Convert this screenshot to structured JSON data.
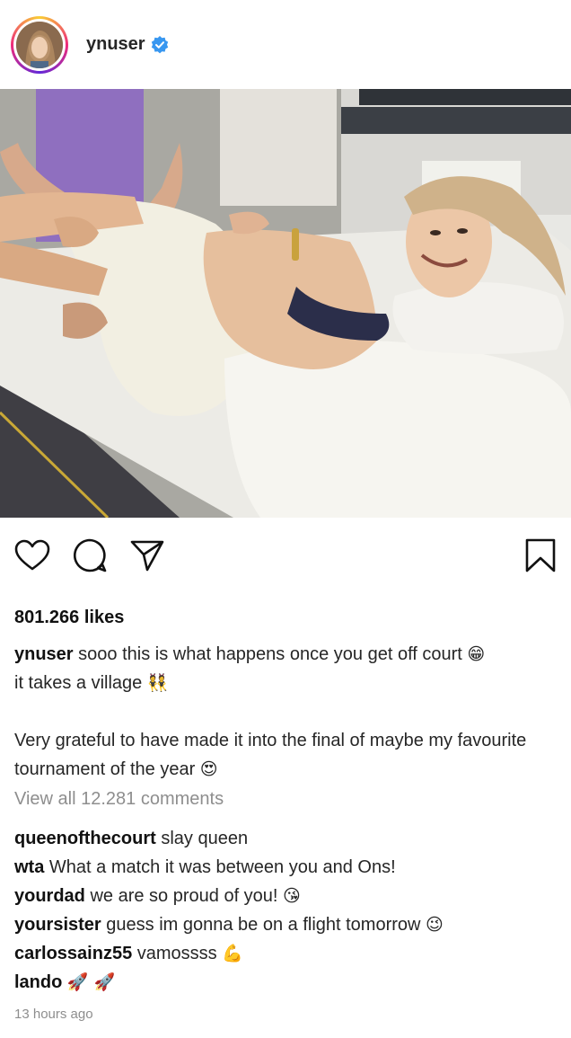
{
  "post": {
    "username": "ynuser",
    "verified_icon": "verified-badge-icon",
    "likes": "801.266 likes",
    "caption": {
      "username": "ynuser",
      "line1_text": "sooo this is what happens once you get off court",
      "line1_emoji": "😁",
      "line2_text": "it takes a village",
      "line2_emoji": "👯",
      "para2_text": "Very grateful to have made it into the final of maybe my favourite tournament of the year",
      "para2_emoji": "😍"
    },
    "view_all_comments": "View all 12.281 comments",
    "comments": [
      {
        "username": "queenofthecourt",
        "text": "slay queen",
        "emoji": ""
      },
      {
        "username": "wta",
        "text": "What a match it was between you and Ons!",
        "emoji": ""
      },
      {
        "username": "yourdad",
        "text": "we are so proud of you!",
        "emoji": "😘"
      },
      {
        "username": "yoursister",
        "text": "guess im gonna be on a flight tomorrow",
        "emoji": "😉"
      },
      {
        "username": "carlossainz55",
        "text": "vamossss",
        "emoji": "💪"
      },
      {
        "username": "lando",
        "text": "",
        "emoji": "🚀 🚀"
      }
    ],
    "timestamp": "13 hours ago"
  },
  "icons": {
    "like": "heart-icon",
    "comment": "speech-bubble-icon",
    "share": "paper-plane-icon",
    "save": "bookmark-icon"
  },
  "colors": {
    "verified_blue": "#3897f0",
    "muted_text": "#8e8e8e",
    "primary_text": "#262626"
  }
}
